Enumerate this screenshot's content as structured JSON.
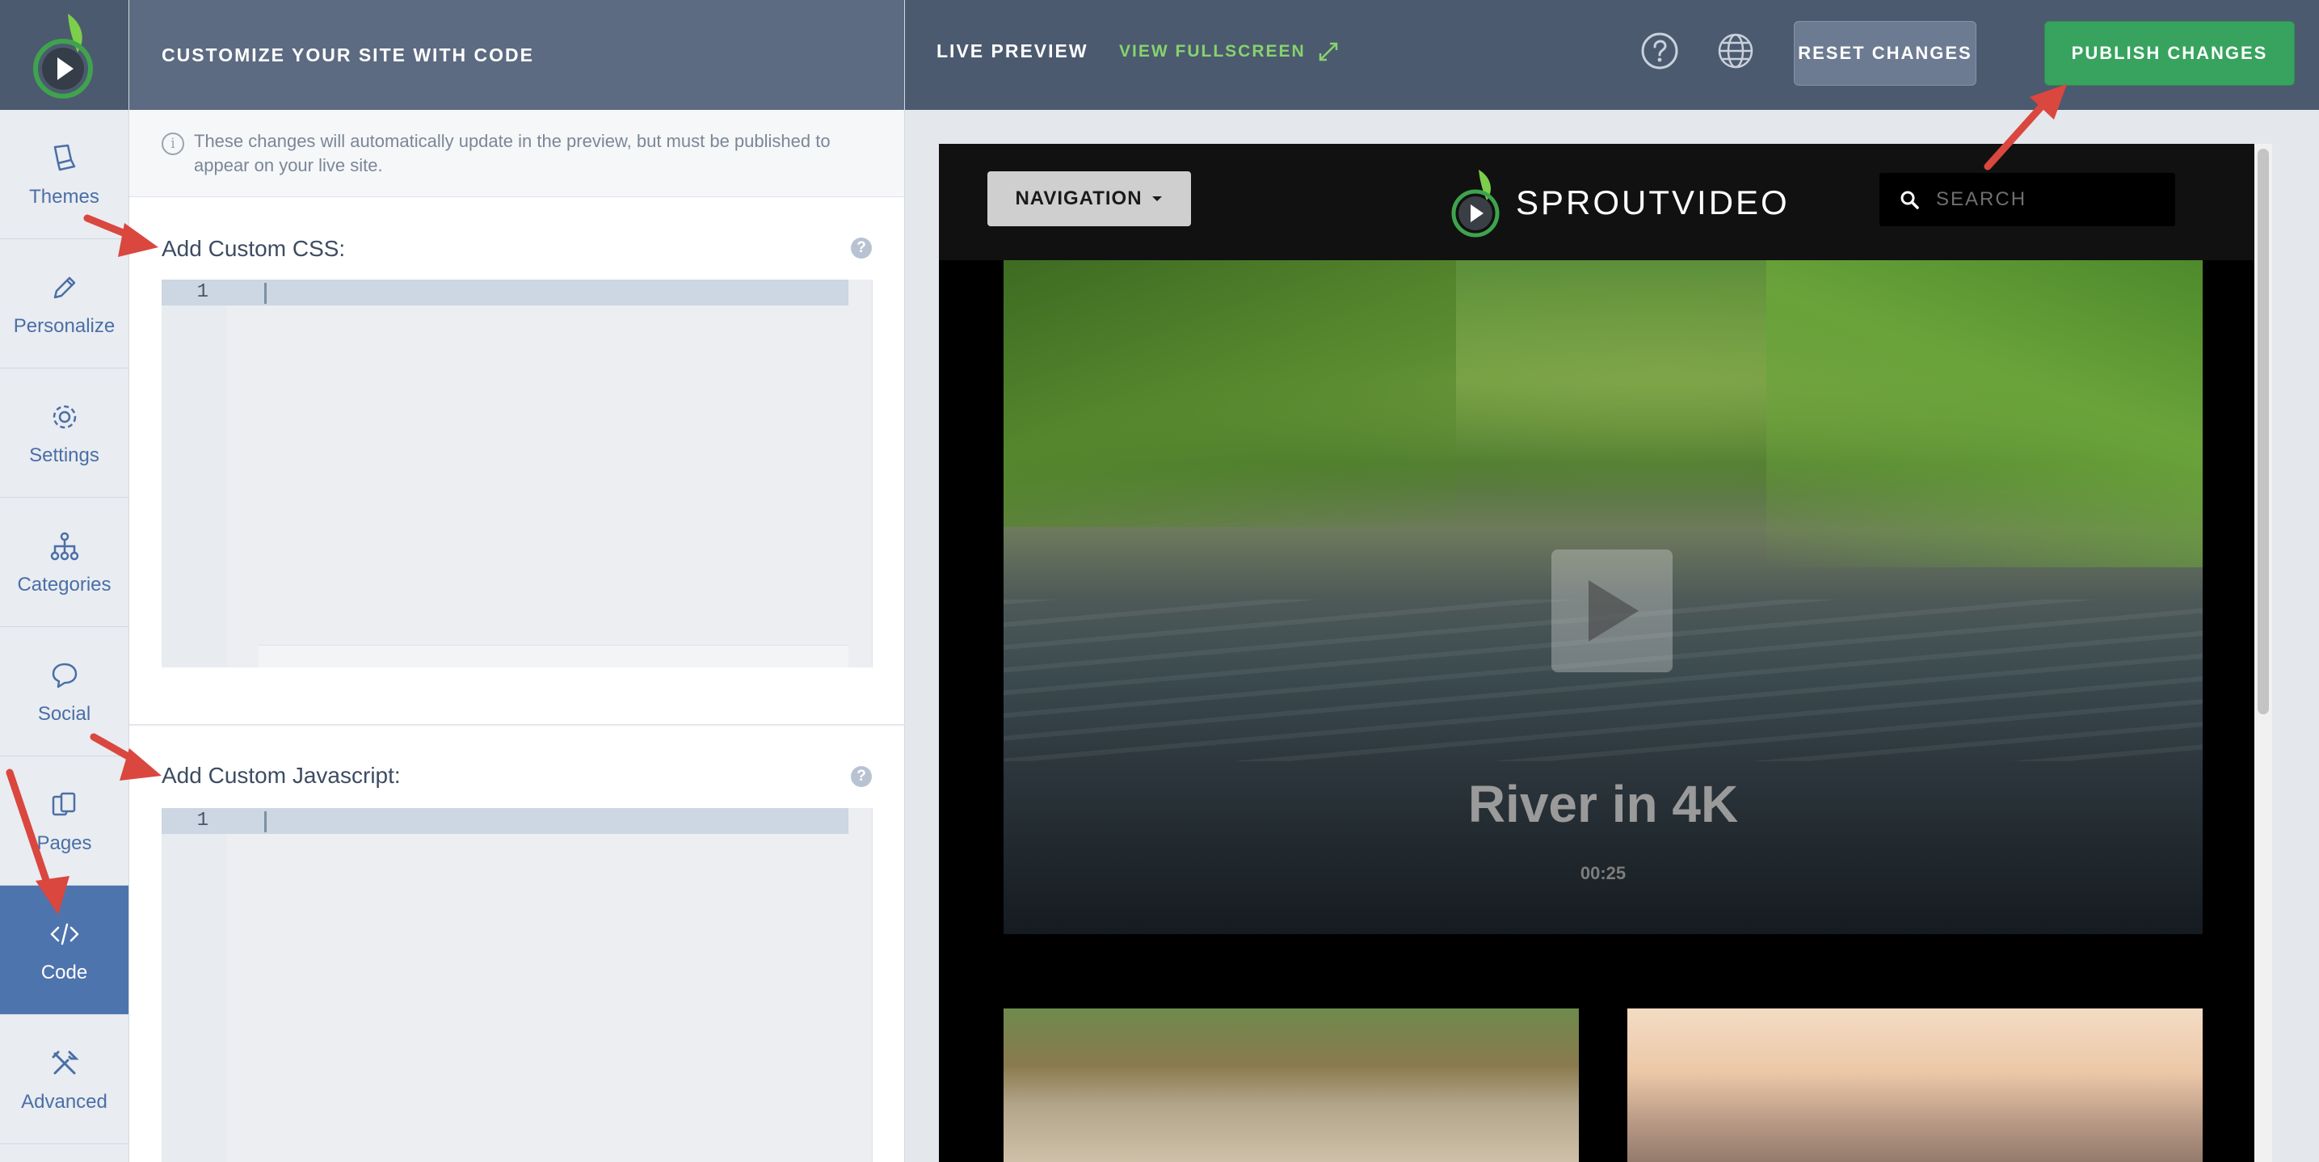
{
  "rail": {
    "items": [
      {
        "label": "Themes",
        "icon": "themes-icon"
      },
      {
        "label": "Personalize",
        "icon": "pencil-icon"
      },
      {
        "label": "Settings",
        "icon": "gear-icon"
      },
      {
        "label": "Categories",
        "icon": "hierarchy-icon"
      },
      {
        "label": "Social",
        "icon": "speech-bubble-icon"
      },
      {
        "label": "Pages",
        "icon": "pages-icon"
      },
      {
        "label": "Code",
        "icon": "code-icon",
        "active": true
      },
      {
        "label": "Advanced",
        "icon": "tools-icon"
      }
    ]
  },
  "panel": {
    "title": "CUSTOMIZE YOUR SITE WITH CODE",
    "notice_line1": "These changes will automatically update in the preview, but must be published to",
    "notice_line2": "appear on your live site.",
    "css_title": "Add Custom CSS:",
    "js_title": "Add Custom Javascript:",
    "line_number": "1",
    "help": "?"
  },
  "topbar": {
    "live_preview": "LIVE PREVIEW",
    "view_fullscreen": "VIEW FULLSCREEN",
    "reset": "RESET CHANGES",
    "publish": "PUBLISH CHANGES"
  },
  "preview": {
    "nav_label": "NAVIGATION",
    "brand": "SPROUTVIDEO",
    "search_placeholder": "SEARCH",
    "hero_title": "River in 4K",
    "hero_duration": "00:25"
  },
  "colors": {
    "header_bg": "#4c5a6f",
    "accent_blue": "#4e74ae",
    "publish_green": "#37a35e",
    "fullscreen_green": "#86d36e",
    "annotation_red": "#d9473f"
  }
}
